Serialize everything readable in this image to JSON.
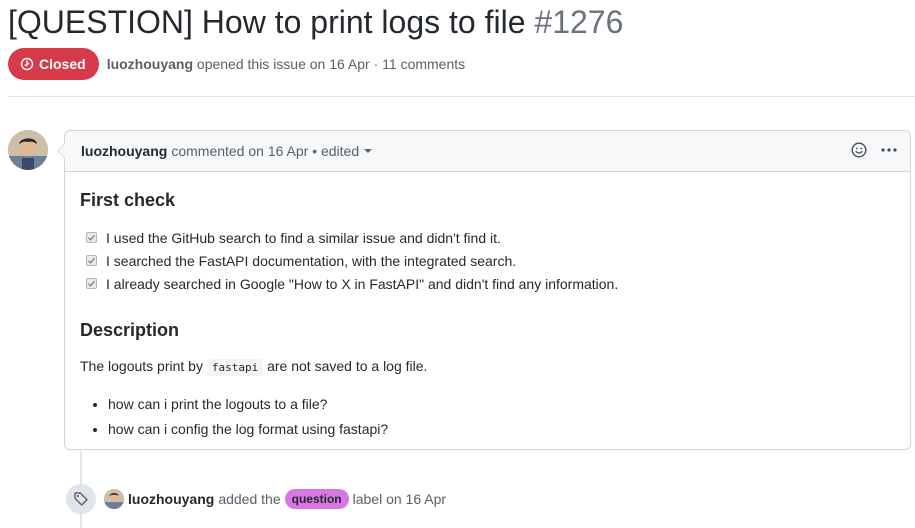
{
  "issue": {
    "title": "[QUESTION] How to print logs to file",
    "number": "#1276",
    "state_label": "Closed",
    "author": "luozhouyang",
    "meta_text": "opened this issue on 16 Apr · 11 comments"
  },
  "comment": {
    "author": "luozhouyang",
    "header_text": "commented on 16 Apr • edited",
    "first_check_heading": "First check",
    "checks": [
      "I used the GitHub search to find a similar issue and didn't find it.",
      "I searched the FastAPI documentation, with the integrated search.",
      "I already searched in Google \"How to X in FastAPI\" and didn't find any information."
    ],
    "description_heading": "Description",
    "para_before": "The logouts print by",
    "para_code": "fastapi",
    "para_after": "are not saved to a log file.",
    "bullets": [
      "how can i print the logouts to a file?",
      "how can i config the log format using fastapi?"
    ]
  },
  "event": {
    "author": "luozhouyang",
    "text_before": "added the",
    "label": "question",
    "label_color": "#d876e3",
    "text_after": "label on 16 Apr"
  },
  "icons": [
    "issue-closed-icon",
    "smiley-icon",
    "kebab-horizontal-icon",
    "tag-icon",
    "checkbox-checked-icon",
    "caret-down-icon"
  ],
  "colors": {
    "closed": "#d73a49",
    "muted": "#586069",
    "text": "#24292e",
    "border": "#d1d5da"
  }
}
